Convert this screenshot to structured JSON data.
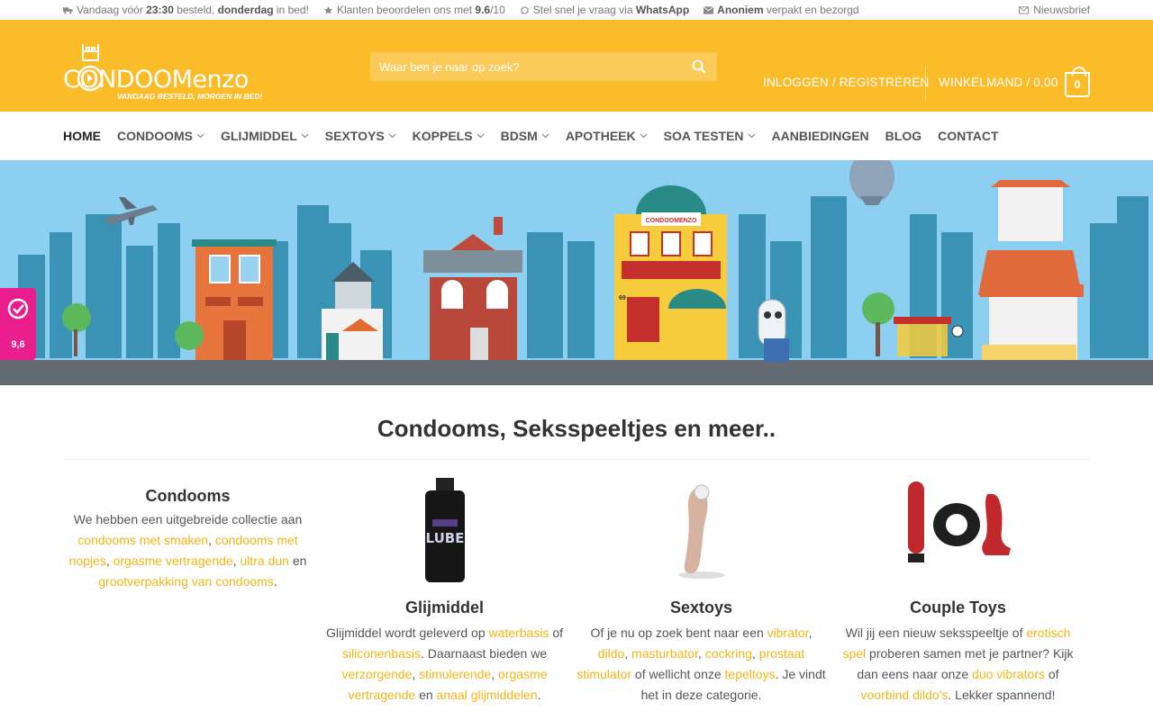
{
  "topbar": {
    "delivery": {
      "prefix": "Vandaag vóór ",
      "time": "23:30",
      "mid": " besteld, ",
      "day": "donderdag",
      "suffix": " in bed!"
    },
    "reviews": {
      "prefix": "Klanten beoordelen ons met ",
      "score": "9.6",
      "suffix": "/10"
    },
    "whatsapp": {
      "prefix": "Stel snel je vraag via ",
      "name": "WhatsApp"
    },
    "anonymous": {
      "bold": "Anoniem",
      "suffix": " verpakt en bezorgd"
    },
    "newsletter": "Nieuwsbrief"
  },
  "header": {
    "logo_text": "CONDOOMenzo",
    "logo_tagline": "VANDAAG BESTELD, MORGEN IN BED!",
    "search_placeholder": "Waar ben je naar op zoek?",
    "login": "INLOGGEN / REGISTREREN",
    "cart": "WINKELMAND / 0,00",
    "cart_count": "0",
    "brand_color": "#fbbc29"
  },
  "nav": {
    "items": [
      {
        "label": "HOME",
        "dropdown": false
      },
      {
        "label": "CONDOOMS",
        "dropdown": true
      },
      {
        "label": "GLIJMIDDEL",
        "dropdown": true
      },
      {
        "label": "SEXTOYS",
        "dropdown": true
      },
      {
        "label": "KOPPELS",
        "dropdown": true
      },
      {
        "label": "BDSM",
        "dropdown": true
      },
      {
        "label": "APOTHEEK",
        "dropdown": true
      },
      {
        "label": "SOA TESTEN",
        "dropdown": true
      },
      {
        "label": "AANBIEDINGEN",
        "dropdown": false
      },
      {
        "label": "BLOG",
        "dropdown": false
      },
      {
        "label": "CONTACT",
        "dropdown": false
      }
    ]
  },
  "hero": {
    "shop_sign": "CONDOOMENZO",
    "house_number": "69"
  },
  "badge": {
    "score": "9,6"
  },
  "main": {
    "title": "Condooms, Seksspeeltjes en meer..",
    "condooms": {
      "title": "Condooms",
      "t1": "We hebben een uitgebreide collectie aan ",
      "l1": "condooms met smaken",
      "t2": ", ",
      "l2": "condooms met nopjes",
      "t3": ", ",
      "l3": "orgasme vertragende",
      "t4": ", ",
      "l4": "ultra dun",
      "t5": " en ",
      "l5": "grootverpakking van condooms",
      "t6": "."
    },
    "glijmiddel": {
      "title": "Glijmiddel",
      "t1": "Glijmiddel wordt geleverd op ",
      "l1": "waterbasis",
      "t2": " of ",
      "l2": "siliconenbasis",
      "t3": ". Daarnaast bieden we ",
      "l3": "verzorgende",
      "t4": ", ",
      "l4": "stimulerende",
      "t5": ", ",
      "l5": "orgasme vertragende",
      "t6": " en ",
      "l6": "anaal glijmiddelen",
      "t7": "."
    },
    "sextoys": {
      "title": "Sextoys",
      "t1": "Of je nu op zoek bent naar een ",
      "l1": "vibrator",
      "t2": ", ",
      "l2": "dildo",
      "t3": ", ",
      "l3": "masturbator",
      "t4": ", ",
      "l4": "cockring",
      "t5": ", ",
      "l5": "prostaat stimulator",
      "t6": " of wellicht onze ",
      "l6": "tepeltoys",
      "t7": ". Je vindt het in deze categorie."
    },
    "couple": {
      "title": "Couple Toys",
      "t1": "Wil jij een nieuw seksspeeltje of ",
      "l1": "erotisch spel",
      "t2": " proberen samen met je partner? Kijk dan eens naar onze ",
      "l2": "duo vibrators",
      "t3": " of ",
      "l3": "voorbind dildo's",
      "t4": ". Lekker spannend!"
    },
    "link_color": "#f1b517"
  }
}
